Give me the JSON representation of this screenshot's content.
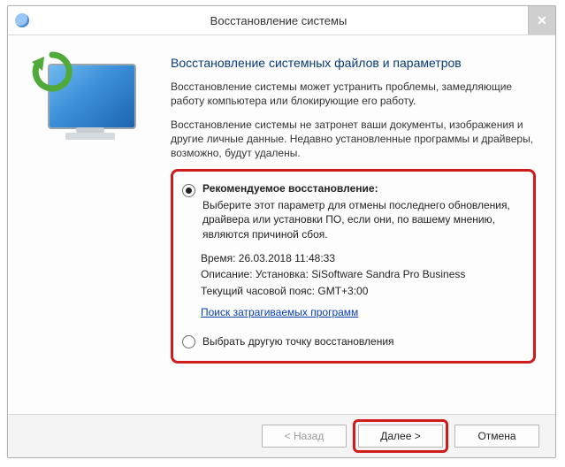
{
  "window": {
    "title": "Восстановление системы",
    "close_x": "✕"
  },
  "heading": "Восстановление системных файлов и параметров",
  "intro1": "Восстановление системы может устранить проблемы, замедляющие работу компьютера или блокирующие его работу.",
  "intro2": "Восстановление системы не затронет ваши документы, изображения и другие личные данные. Недавно установленные программы и драйверы, возможно, будут удалены.",
  "option_recommended": {
    "label": "Рекомендуемое восстановление:",
    "desc": "Выберите этот параметр для отмены последнего обновления, драйвера или установки ПО, если они, по вашему мнению, являются причиной сбоя.",
    "time_lbl": "Время:",
    "time_val": "26.03.2018 11:48:33",
    "desc_lbl": "Описание:",
    "desc_val": "Установка: SiSoftware Sandra Pro Business",
    "tz_lbl": "Текущий часовой пояс:",
    "tz_val": "GMT+3:00",
    "link": "Поиск затрагиваемых программ"
  },
  "option_choose": {
    "label": "Выбрать другую точку восстановления"
  },
  "buttons": {
    "back": "< Назад",
    "next": "Далее >",
    "cancel": "Отмена"
  }
}
